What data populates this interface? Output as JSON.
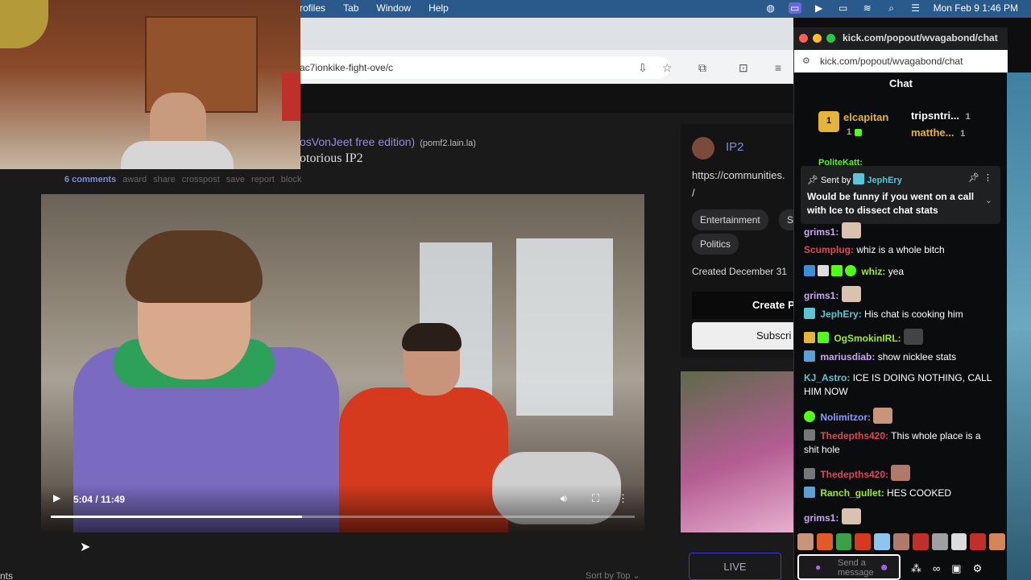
{
  "menubar": {
    "menus": [
      "rofiles",
      "Tab",
      "Window",
      "Help"
    ],
    "datetime": "Mon Feb 9  1:46 PM"
  },
  "browser": {
    "url_fragment": "ac7ionkike-fight-ove/c"
  },
  "post": {
    "title": "osVonJeet free edition)",
    "domain": "(pomf2.lain.la)",
    "subtitle": "otorious IP2",
    "actions": [
      "6 comments",
      "award",
      "share",
      "crosspost",
      "save",
      "report",
      "block"
    ]
  },
  "video": {
    "time": "5:04 / 11:49",
    "progress": 0.43
  },
  "sidebar": {
    "name": "IP2",
    "url": "https://communities.",
    "url_cont": "/",
    "tags": [
      "Entertainment",
      "S",
      "Politics"
    ],
    "created": "Created December 31",
    "create_label": "Create P",
    "subscribe_label": "Subscri",
    "live_label": "LIVE"
  },
  "page_misc": {
    "sort_label": "Sort by Top ⌄",
    "left_text": "nts"
  },
  "chat": {
    "window_title": "kick.com/popout/wvagabond/chat",
    "url": "kick.com/popout/wvagabond/chat",
    "header": "Chat",
    "leaderboard": [
      {
        "rank": "1",
        "name": "elcapitan",
        "count": "1",
        "color": "#e6b43a"
      },
      {
        "name": "tripsntri...",
        "count": "1",
        "color": "#ffffff"
      },
      {
        "name": "matthe...",
        "count": "1",
        "color": "#e6b43a"
      }
    ],
    "pinned": {
      "sent_by_label": "Sent by",
      "sender": "JephEry",
      "message": "Would be funny if you went on a call with Ice to dissect chat stats"
    },
    "partial_user": "PoliteKatt:",
    "messages": [
      {
        "user": "grims1:",
        "color": "#c9a7f0",
        "text": ""
      },
      {
        "user": "Scumplug:",
        "color": "#e0485a",
        "text": "whiz is a whole bitch"
      },
      {
        "user": "whiz:",
        "color": "#a3e635",
        "text": "yea"
      },
      {
        "user": "grims1:",
        "color": "#c9a7f0",
        "text": ""
      },
      {
        "user": "JephEry:",
        "color": "#5bc7d6",
        "text": "His chat is cooking him"
      },
      {
        "user": "OgSmokinIRL:",
        "color": "#a3e635",
        "text": ""
      },
      {
        "user": "mariusdiab:",
        "color": "#c9a7f0",
        "text": "show nicklee stats"
      },
      {
        "user": "KJ_Astro:",
        "color": "#5bc7d6",
        "text": "ICE IS DOING NOTHING, CALL HIM NOW"
      },
      {
        "user": "Nolimitzor:",
        "color": "#8b9cff",
        "text": ""
      },
      {
        "user": "Thedepths420:",
        "color": "#e0485a",
        "text": "This whole place is a shit hole"
      },
      {
        "user": "Thedepths420:",
        "color": "#e0485a",
        "text": ""
      },
      {
        "user": "Ranch_gullet:",
        "color": "#a3e635",
        "text": "HES COOKED"
      },
      {
        "user": "grims1:",
        "color": "#c9a7f0",
        "text": ""
      }
    ],
    "input_placeholder": "Send a message"
  },
  "colors": {
    "accent": "#53fc18",
    "link": "#7c8fd6"
  }
}
